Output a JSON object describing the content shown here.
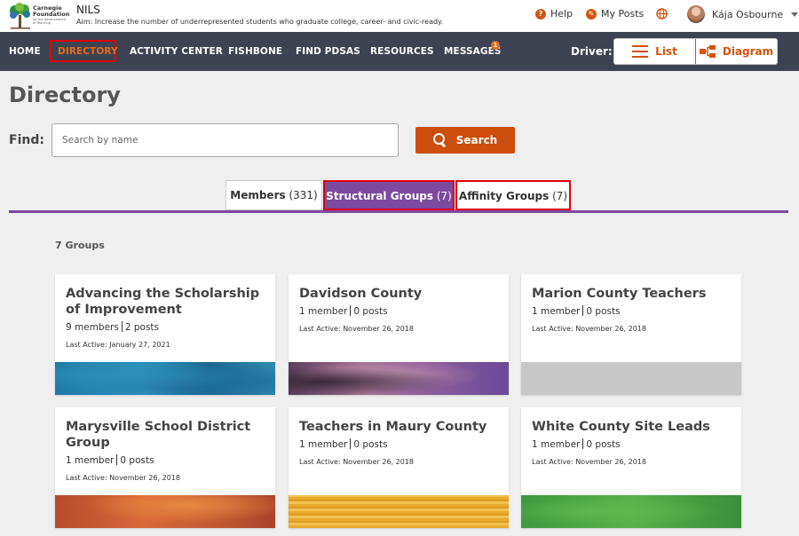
{
  "header": {
    "logo_line1": "Carnegie",
    "logo_line2": "Foundation",
    "logo_line3": "for the Advancement",
    "logo_line4": "of Teaching",
    "org_name": "NILS",
    "aim": "Aim:  Increase the number of underrepresented students who graduate college, career- and civic-ready.",
    "help_label": "Help",
    "myposts_label": "My Posts",
    "user_name": "Kája Osbourne"
  },
  "nav": {
    "items": [
      "HOME",
      "DIRECTORY",
      "ACTIVITY CENTER",
      "FISHBONE",
      "FIND PDSAS",
      "RESOURCES",
      "MESSAGES"
    ],
    "messages_badge": "1",
    "driver_label": "Driver:",
    "list_label": "List",
    "diagram_label": "Diagram"
  },
  "page": {
    "title": "Directory",
    "find_label": "Find:",
    "search_placeholder": "Search by name",
    "search_button": "Search"
  },
  "tabs": [
    {
      "label": "Members",
      "count": "(331)"
    },
    {
      "label": "Structural Groups",
      "count": "(7)"
    },
    {
      "label": "Affinity Groups",
      "count": "(7)"
    }
  ],
  "groups_count": "7 Groups",
  "cards": [
    {
      "title": "Advancing the Scholarship of Improvement",
      "members": "9 members",
      "posts": "2 posts",
      "last_active": "Last Active: January 27, 2021"
    },
    {
      "title": "Davidson County",
      "members": "1 member",
      "posts": "0 posts",
      "last_active": "Last Active: November 26, 2018"
    },
    {
      "title": "Marion County Teachers",
      "members": "1 member",
      "posts": "0 posts",
      "last_active": "Last Active: November 26, 2018"
    },
    {
      "title": "Marysville School District Group",
      "members": "1 member",
      "posts": "0 posts",
      "last_active": "Last Active: November 26, 2018"
    },
    {
      "title": "Teachers in Maury County",
      "members": "1 member",
      "posts": "0 posts",
      "last_active": "Last Active: November 26, 2018"
    },
    {
      "title": "White County Site Leads",
      "members": "1 member",
      "posts": "0 posts",
      "last_active": "Last Active: November 26, 2018"
    }
  ],
  "colors": {
    "nav_bg": "#3d4350",
    "accent_orange": "#cc4d0c",
    "tab_purple": "#7c4a9e",
    "highlight_red": "#e0000b"
  }
}
